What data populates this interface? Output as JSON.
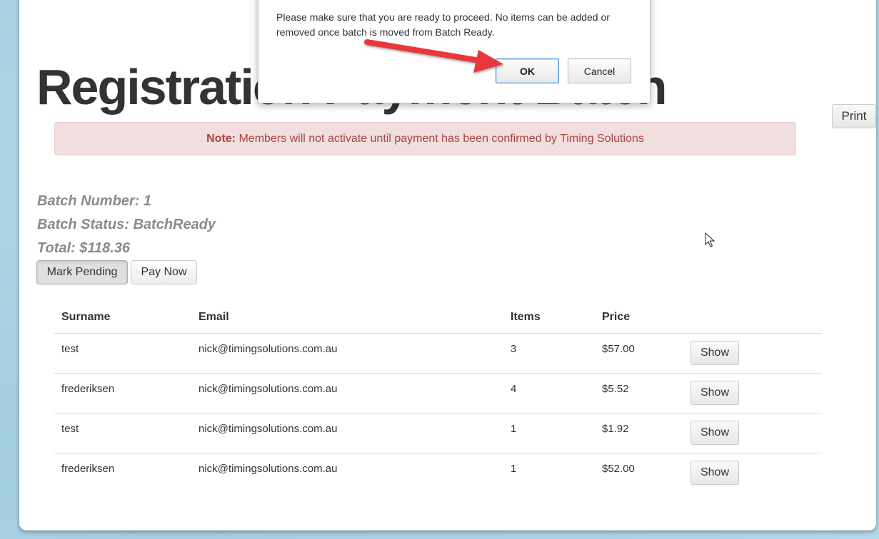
{
  "heading": "Registration Payment Batch",
  "print_label": "Print",
  "note": {
    "label": "Note:",
    "text": "Members will not activate until payment has been confirmed by Timing Solutions"
  },
  "batch": {
    "number_line": "Batch Number: 1",
    "status_line": "Batch Status: BatchReady",
    "total_line": "Total: $118.36"
  },
  "actions": {
    "mark_pending_label": "Mark Pending",
    "pay_now_label": "Pay Now"
  },
  "table": {
    "columns": [
      "Surname",
      "Email",
      "Items",
      "Price"
    ],
    "rows": [
      {
        "surname": "test",
        "email": "nick@timingsolutions.com.au",
        "items": "3",
        "price": "$57.00",
        "action": "Show"
      },
      {
        "surname": "frederiksen",
        "email": "nick@timingsolutions.com.au",
        "items": "4",
        "price": "$5.52",
        "action": "Show"
      },
      {
        "surname": "test",
        "email": "nick@timingsolutions.com.au",
        "items": "1",
        "price": "$1.92",
        "action": "Show"
      },
      {
        "surname": "frederiksen",
        "email": "nick@timingsolutions.com.au",
        "items": "1",
        "price": "$52.00",
        "action": "Show"
      }
    ]
  },
  "dialog": {
    "message": "Please make sure that you are ready to proceed. No items can be added or removed once batch is moved from Batch Ready.",
    "ok_label": "OK",
    "cancel_label": "Cancel"
  },
  "colors": {
    "note_bg": "#f2dede",
    "note_text": "#a94442",
    "arrow": "#e8373a",
    "background": "#a9d3e3"
  },
  "icons": {
    "arrow": "red-annotation-arrow",
    "cursor": "mouse-pointer-icon"
  }
}
